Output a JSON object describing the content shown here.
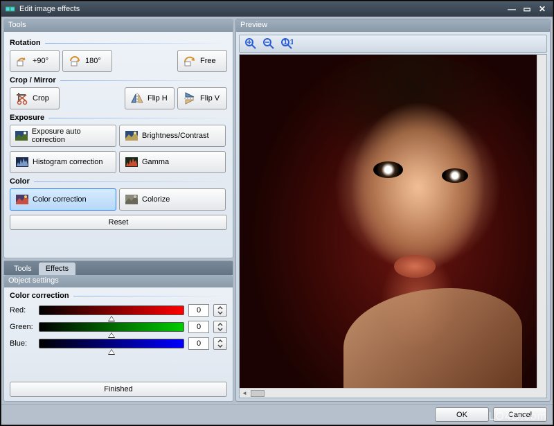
{
  "window": {
    "title": "Edit image effects"
  },
  "panes": {
    "tools": "Tools",
    "preview": "Preview",
    "settings": "Object settings"
  },
  "sections": {
    "rotation": "Rotation",
    "cropmirror": "Crop / Mirror",
    "exposure": "Exposure",
    "color": "Color",
    "colorcorrection": "Color correction"
  },
  "buttons": {
    "rot90": "+90°",
    "rot180": "180°",
    "rotfree": "Free",
    "crop": "Crop",
    "fliph": "Flip H",
    "flipv": "Flip V",
    "expauto": "Exposure auto correction",
    "brightcontrast": "Brightness/Contrast",
    "histogram": "Histogram correction",
    "gamma": "Gamma",
    "colorcorr": "Color correction",
    "colorize": "Colorize",
    "reset": "Reset",
    "finished": "Finished",
    "ok": "OK",
    "cancel": "Cancel"
  },
  "tabs": {
    "tools": "Tools",
    "effects": "Effects"
  },
  "sliders": {
    "red": {
      "label": "Red:",
      "value": "0"
    },
    "green": {
      "label": "Green:",
      "value": "0"
    },
    "blue": {
      "label": "Blue:",
      "value": "0"
    }
  },
  "watermark": "LO4D.com"
}
